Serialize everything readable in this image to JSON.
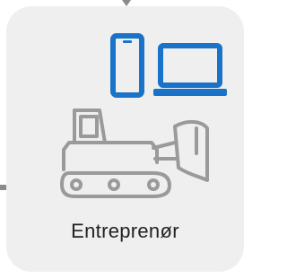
{
  "card": {
    "label": "Entreprenør",
    "background": "#efefef",
    "icons": [
      "devices-icon",
      "construction-machine-icon"
    ]
  },
  "colors": {
    "accent": "#1a73c8",
    "icon_gray": "#9a9a9a",
    "connector": "#8a8a8a"
  }
}
